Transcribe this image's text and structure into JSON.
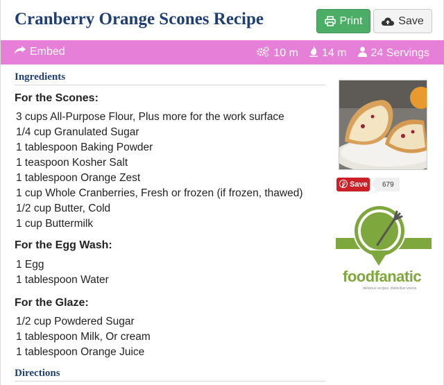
{
  "header": {
    "title": "Cranberry Orange Scones Recipe",
    "print_label": "Print",
    "save_label": "Save"
  },
  "bar": {
    "embed_label": "Embed",
    "prep_time": "10 m",
    "cook_time": "14 m",
    "servings": "24 Servings"
  },
  "ingredients": {
    "heading": "Ingredients",
    "groups": [
      {
        "title": "For the Scones:",
        "items": [
          "3 cups All-Purpose Flour, Plus more for the work surface",
          "1/4 cup Granulated Sugar",
          "1 tablespoon Baking Powder",
          "1 teaspoon Kosher Salt",
          "1 tablespoon Orange Zest",
          "1 cup Whole Cranberries, Fresh or frozen (if frozen, thawed)",
          "1/2 cup Butter, Cold",
          "1 cup Buttermilk"
        ]
      },
      {
        "title": "For the Egg Wash:",
        "items": [
          "1 Egg",
          "1 tablespoon Water"
        ]
      },
      {
        "title": "For the Glaze:",
        "items": [
          "1/2 cup Powdered Sugar",
          "1 tablespoon Milk, Or cream",
          "1 tablespoon Orange Juice"
        ]
      }
    ]
  },
  "directions": {
    "heading": "Directions"
  },
  "sidebar": {
    "pin_label": "Save",
    "pin_count": "679",
    "logo_word": "foodfanatic",
    "logo_tagline": "delicious recipes. distinctive voices."
  },
  "colors": {
    "title": "#1f3f73",
    "bar": "#e67fd7",
    "print_button": "#4cae66",
    "pinterest": "#cb2027",
    "logo_green": "#7ea83d"
  },
  "icons": [
    "print-icon",
    "cloud-upload-icon",
    "share-icon",
    "gears-icon",
    "fire-icon",
    "user-icon",
    "pinterest-icon"
  ]
}
